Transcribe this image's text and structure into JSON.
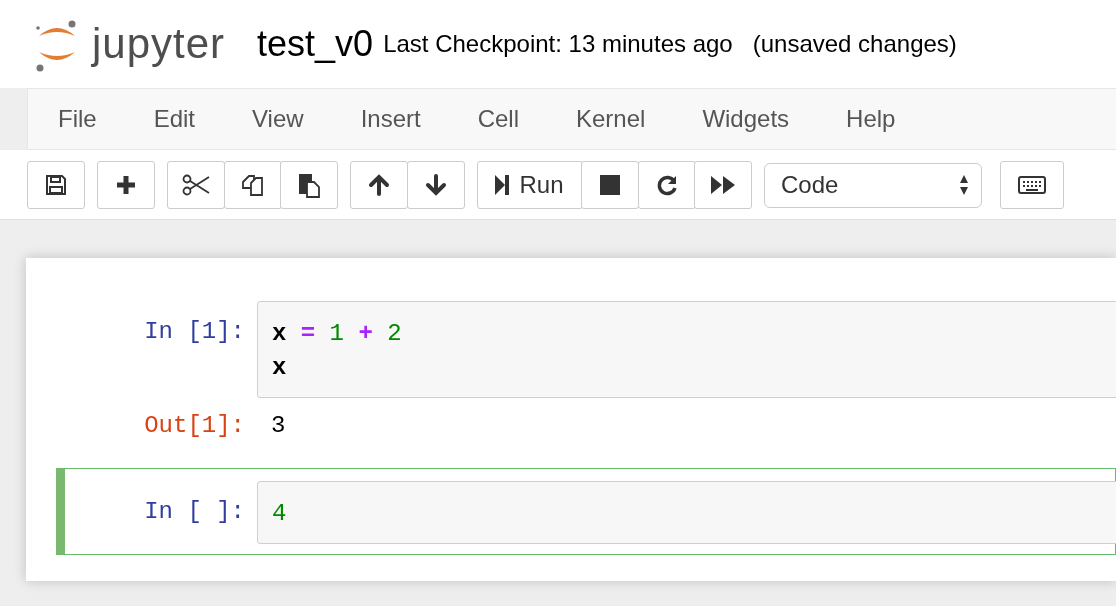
{
  "header": {
    "logo_text": "jupyter",
    "notebook_name": "test_v0",
    "checkpoint": "Last Checkpoint: 13 minutes ago",
    "save_status": "(unsaved changes)"
  },
  "menu": [
    "File",
    "Edit",
    "View",
    "Insert",
    "Cell",
    "Kernel",
    "Widgets",
    "Help"
  ],
  "toolbar": {
    "run_label": "Run",
    "cell_type": "Code"
  },
  "cells": [
    {
      "prompt": "In [1]:",
      "selected": false,
      "lines": [
        [
          {
            "text": "x",
            "kind": "name"
          },
          {
            "text": "=",
            "kind": "operator"
          },
          {
            "text": "1",
            "kind": "number"
          },
          {
            "text": "+",
            "kind": "operator"
          },
          {
            "text": "2",
            "kind": "number"
          }
        ],
        [
          {
            "text": "x",
            "kind": "name"
          }
        ]
      ],
      "output_prompt": "Out[1]:",
      "output": "3"
    },
    {
      "prompt": "In [ ]:",
      "selected": true,
      "lines": [
        [
          {
            "text": "4",
            "kind": "number"
          }
        ]
      ]
    }
  ]
}
